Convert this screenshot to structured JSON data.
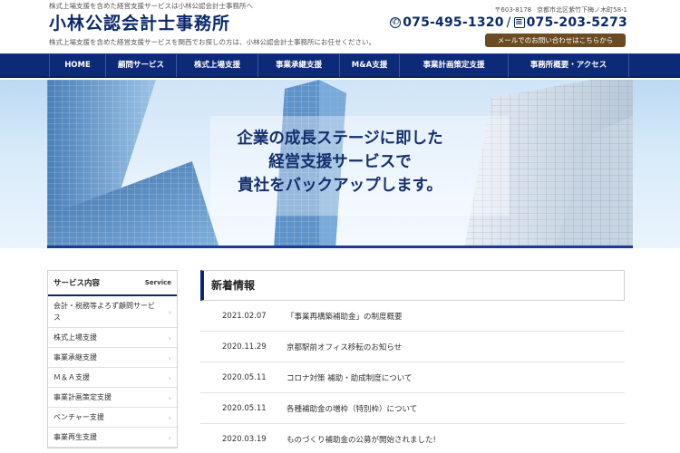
{
  "header": {
    "tagline": "株式上場支援を含めた経営支援サービスは小林公認会計士事務所へ",
    "logo": "小林公認会計士事務所",
    "subtag": "株式上場支援を含めた経営支援サービスを関西でお探しの方は、小林公認会計士事務所にお任せください。",
    "postal": "〒603-8178",
    "address": "京都市北区紫竹下梅ノ木町58-1",
    "tel": "075-495-1320",
    "fax": "075-203-5273",
    "mail_button": "メールでのお問い合わせはこちらから"
  },
  "nav": {
    "items": [
      {
        "label": "HOME"
      },
      {
        "label": "顧問サービス"
      },
      {
        "label": "株式上場支援"
      },
      {
        "label": "事業承継支援"
      },
      {
        "label": "M&A支援"
      },
      {
        "label": "事業計画策定支援"
      },
      {
        "label": "事務所概要・アクセス"
      }
    ]
  },
  "hero": {
    "line1": "企業の成長ステージに即した",
    "line2": "経営支援サービスで",
    "line3": "貴社をバックアップします。"
  },
  "sidebar": {
    "title": "サービス内容",
    "title_en": "Service",
    "items": [
      {
        "label": "会計・税務等よろず顧問サービス"
      },
      {
        "label": "株式上場支援"
      },
      {
        "label": "事業承継支援"
      },
      {
        "label": "Ｍ＆Ａ支援"
      },
      {
        "label": "事業計画策定支援"
      },
      {
        "label": "ベンチャー支援"
      },
      {
        "label": "事業再生支援"
      }
    ]
  },
  "news": {
    "title": "新着情報",
    "items": [
      {
        "date": "2021.02.07",
        "title": "「事業再構築補助金」の制度概要"
      },
      {
        "date": "2020.11.29",
        "title": "京都駅前オフィス移転のお知らせ"
      },
      {
        "date": "2020.05.11",
        "title": "コロナ対策 補助・助成制度について"
      },
      {
        "date": "2020.05.11",
        "title": "各種補助金の増枠（特別枠）について"
      },
      {
        "date": "2020.03.19",
        "title": "ものづくり補助金の公募が開始されました!"
      }
    ]
  },
  "colors": {
    "navy": "#0d2a78",
    "mail_button": "#6b4b22"
  }
}
